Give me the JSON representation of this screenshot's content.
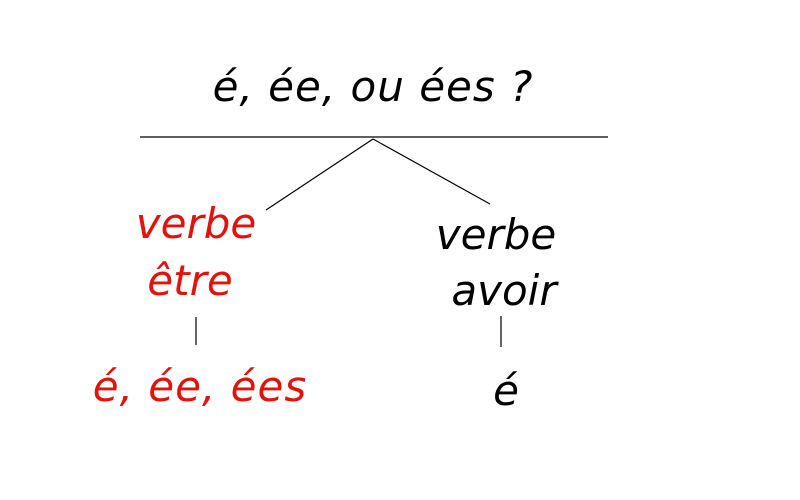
{
  "title": "é, ée, ou ées ?",
  "left_branch": {
    "line1": "verbe",
    "line2": "être",
    "result": "é, ée, ées",
    "color": "#e3120b"
  },
  "right_branch": {
    "line1": "verbe",
    "line2": "avoir",
    "result": "é",
    "color": "#000000"
  },
  "colors": {
    "text": "#000000",
    "line": "#000000",
    "accent": "#e3120b"
  }
}
